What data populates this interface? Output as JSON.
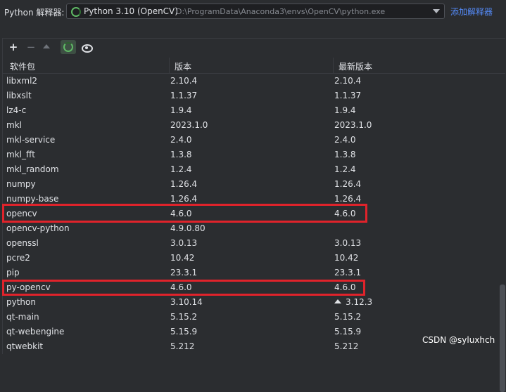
{
  "header": {
    "label": "Python 解释器:",
    "interpreter_name": "Python 3.10 (OpenCV)",
    "interpreter_path": "D:\\ProgramData\\Anaconda3\\envs\\OpenCV\\python.exe",
    "add_interpreter": "添加解释器"
  },
  "toolbar": {
    "add": "+",
    "remove": "−"
  },
  "table": {
    "columns": [
      "软件包",
      "版本",
      "最新版本"
    ],
    "rows": [
      {
        "name": "libxml2",
        "version": "2.10.4",
        "latest": "2.10.4"
      },
      {
        "name": "libxslt",
        "version": "1.1.37",
        "latest": "1.1.37"
      },
      {
        "name": "lz4-c",
        "version": "1.9.4",
        "latest": "1.9.4"
      },
      {
        "name": "mkl",
        "version": "2023.1.0",
        "latest": "2023.1.0"
      },
      {
        "name": "mkl-service",
        "version": "2.4.0",
        "latest": "2.4.0"
      },
      {
        "name": "mkl_fft",
        "version": "1.3.8",
        "latest": "1.3.8"
      },
      {
        "name": "mkl_random",
        "version": "1.2.4",
        "latest": "1.2.4"
      },
      {
        "name": "numpy",
        "version": "1.26.4",
        "latest": "1.26.4"
      },
      {
        "name": "numpy-base",
        "version": "1.26.4",
        "latest": "1.26.4"
      },
      {
        "name": "opencv",
        "version": "4.6.0",
        "latest": "4.6.0"
      },
      {
        "name": "opencv-python",
        "version": "4.9.0.80",
        "latest": ""
      },
      {
        "name": "openssl",
        "version": "3.0.13",
        "latest": "3.0.13"
      },
      {
        "name": "pcre2",
        "version": "10.42",
        "latest": "10.42"
      },
      {
        "name": "pip",
        "version": "23.3.1",
        "latest": "23.3.1"
      },
      {
        "name": "py-opencv",
        "version": "4.6.0",
        "latest": "4.6.0"
      },
      {
        "name": "python",
        "version": "3.10.14",
        "latest": "3.12.3",
        "upgrade": true
      },
      {
        "name": "qt-main",
        "version": "5.15.2",
        "latest": "5.15.2"
      },
      {
        "name": "qt-webengine",
        "version": "5.15.9",
        "latest": "5.15.9"
      },
      {
        "name": "qtwebkit",
        "version": "5.212",
        "latest": "5.212"
      }
    ]
  },
  "watermark": "CSDN @syluxhch",
  "colors": {
    "highlight_box": "#e0232b",
    "link": "#548af7",
    "background": "#2b2d30"
  }
}
